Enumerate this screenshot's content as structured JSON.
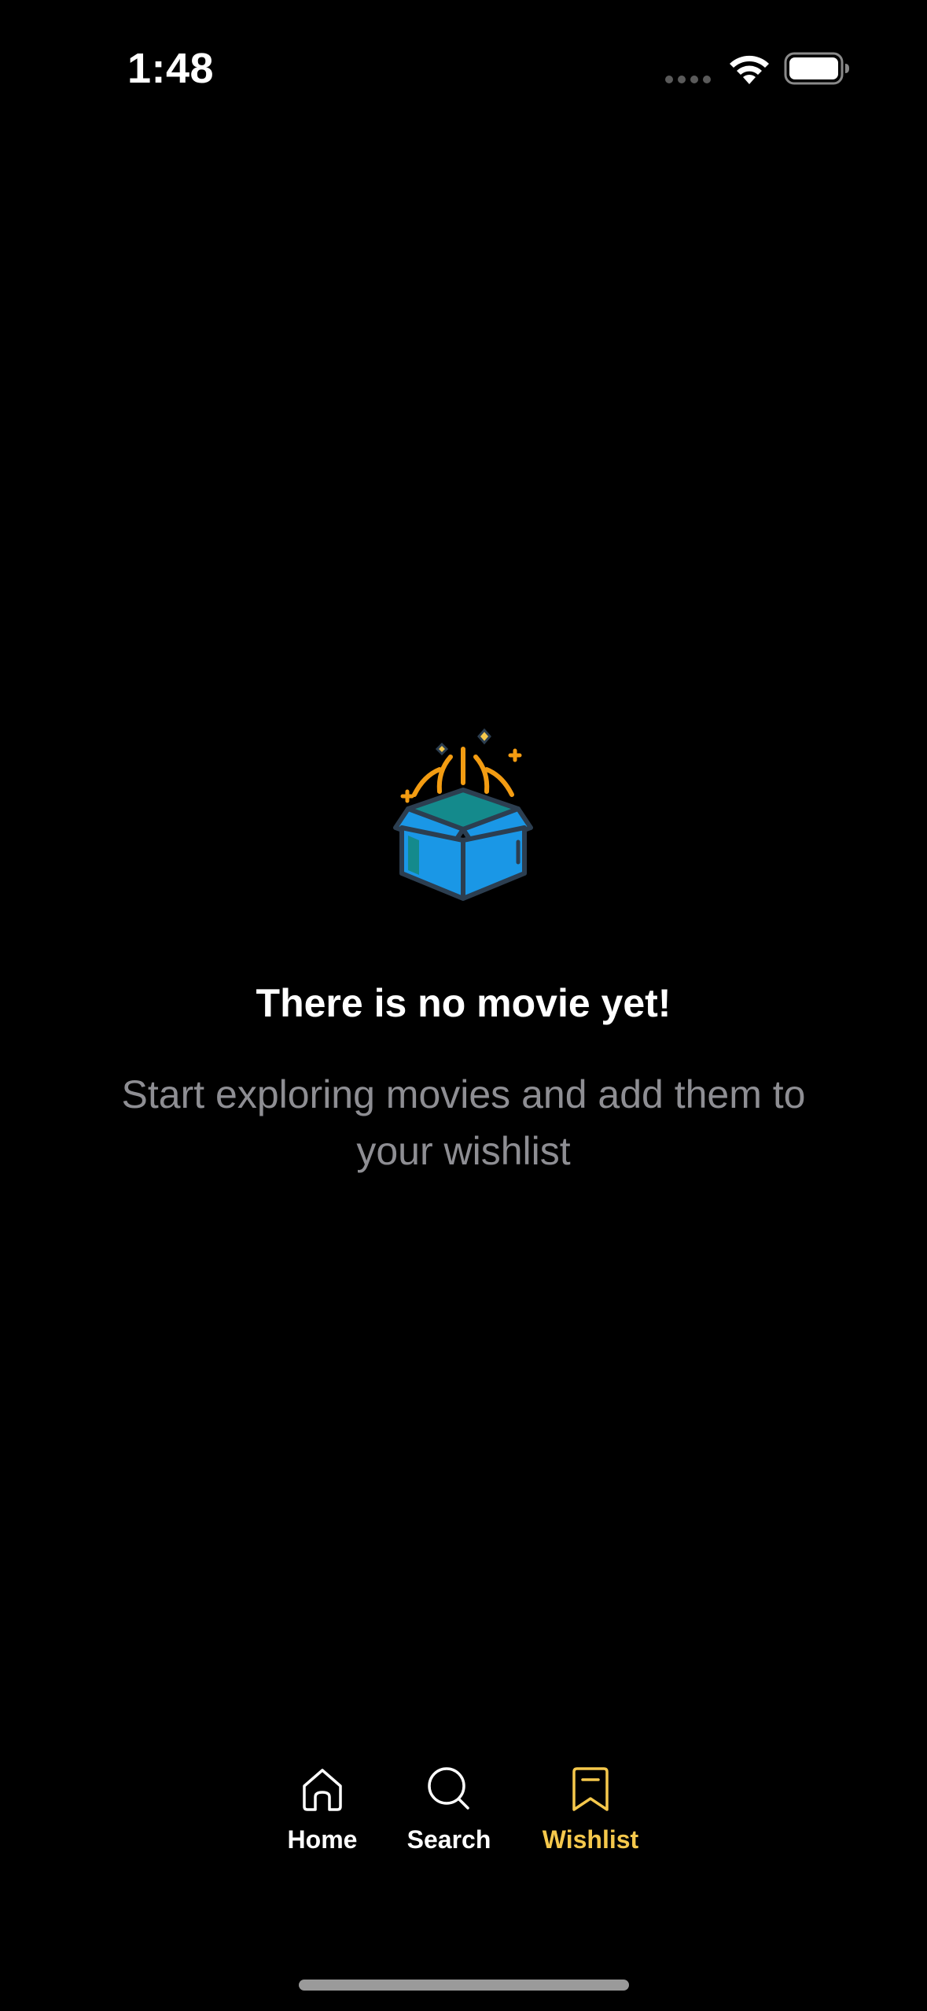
{
  "status_bar": {
    "time": "1:48"
  },
  "empty_state": {
    "title": "There is no movie yet!",
    "subtitle": "Start exploring movies and add them to your wishlist",
    "illustration": "open-box-icon"
  },
  "tab_bar": {
    "items": [
      {
        "label": "Home",
        "icon": "home-icon",
        "active": false
      },
      {
        "label": "Search",
        "icon": "search-icon",
        "active": false
      },
      {
        "label": "Wishlist",
        "icon": "bookmark-icon",
        "active": true
      }
    ]
  },
  "colors": {
    "background": "#000000",
    "accent": "#f5c84c",
    "subtitle": "#8e8e93",
    "box_blue": "#1a97e6",
    "sparkle_orange": "#f39c12"
  }
}
